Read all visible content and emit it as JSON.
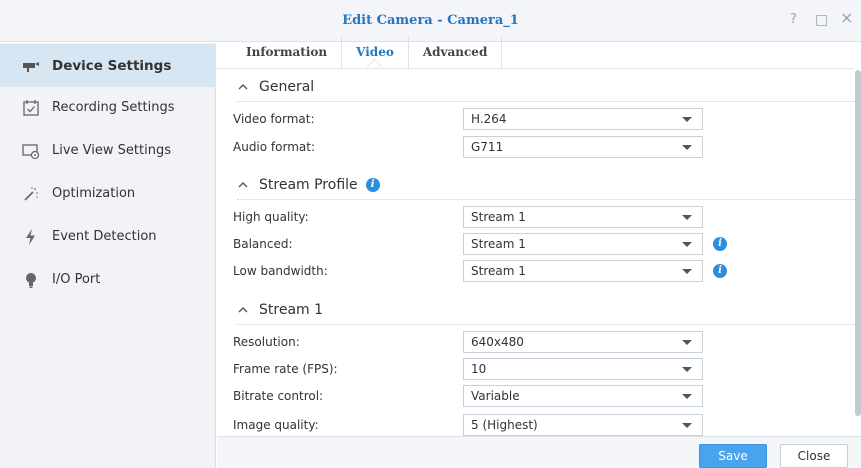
{
  "window": {
    "title": "Edit Camera - Camera_1",
    "help_glyph": "?",
    "maximize_glyph": "□",
    "close_glyph": "×"
  },
  "sidebar": {
    "items": [
      {
        "label": "Device Settings",
        "icon": "camera-icon",
        "active": true
      },
      {
        "label": "Recording Settings",
        "icon": "calendar-check-icon",
        "active": false
      },
      {
        "label": "Live View Settings",
        "icon": "monitor-settings-icon",
        "active": false
      },
      {
        "label": "Optimization",
        "icon": "magic-wand-icon",
        "active": false
      },
      {
        "label": "Event Detection",
        "icon": "lightning-icon",
        "active": false
      },
      {
        "label": "I/O Port",
        "icon": "lightbulb-icon",
        "active": false
      }
    ]
  },
  "tabs": [
    {
      "label": "Information",
      "active": false
    },
    {
      "label": "Video",
      "active": true
    },
    {
      "label": "Advanced",
      "active": false
    }
  ],
  "sections": {
    "general": {
      "title": "General",
      "fields": [
        {
          "label": "Video format:",
          "value": "H.264"
        },
        {
          "label": "Audio format:",
          "value": "G711"
        }
      ]
    },
    "stream_profile": {
      "title": "Stream Profile",
      "info_glyph": "i",
      "fields": [
        {
          "label": "High quality:",
          "value": "Stream 1"
        },
        {
          "label": "Balanced:",
          "value": "Stream 1",
          "info_glyph": "i"
        },
        {
          "label": "Low bandwidth:",
          "value": "Stream 1",
          "info_glyph": "i"
        }
      ]
    },
    "stream1": {
      "title": "Stream 1",
      "fields": [
        {
          "label": "Resolution:",
          "value": "640x480"
        },
        {
          "label": "Frame rate (FPS):",
          "value": "10"
        },
        {
          "label": "Bitrate control:",
          "value": "Variable"
        },
        {
          "label": "Image quality:",
          "value": "5 (Highest)"
        }
      ]
    }
  },
  "footer": {
    "save_label": "Save",
    "close_label": "Close"
  },
  "colors": {
    "accent": "#1f77c4",
    "save_button": "#4aa3ef",
    "info_icon": "#2d8ee0",
    "sidebar_active": "#d6e6f3"
  }
}
